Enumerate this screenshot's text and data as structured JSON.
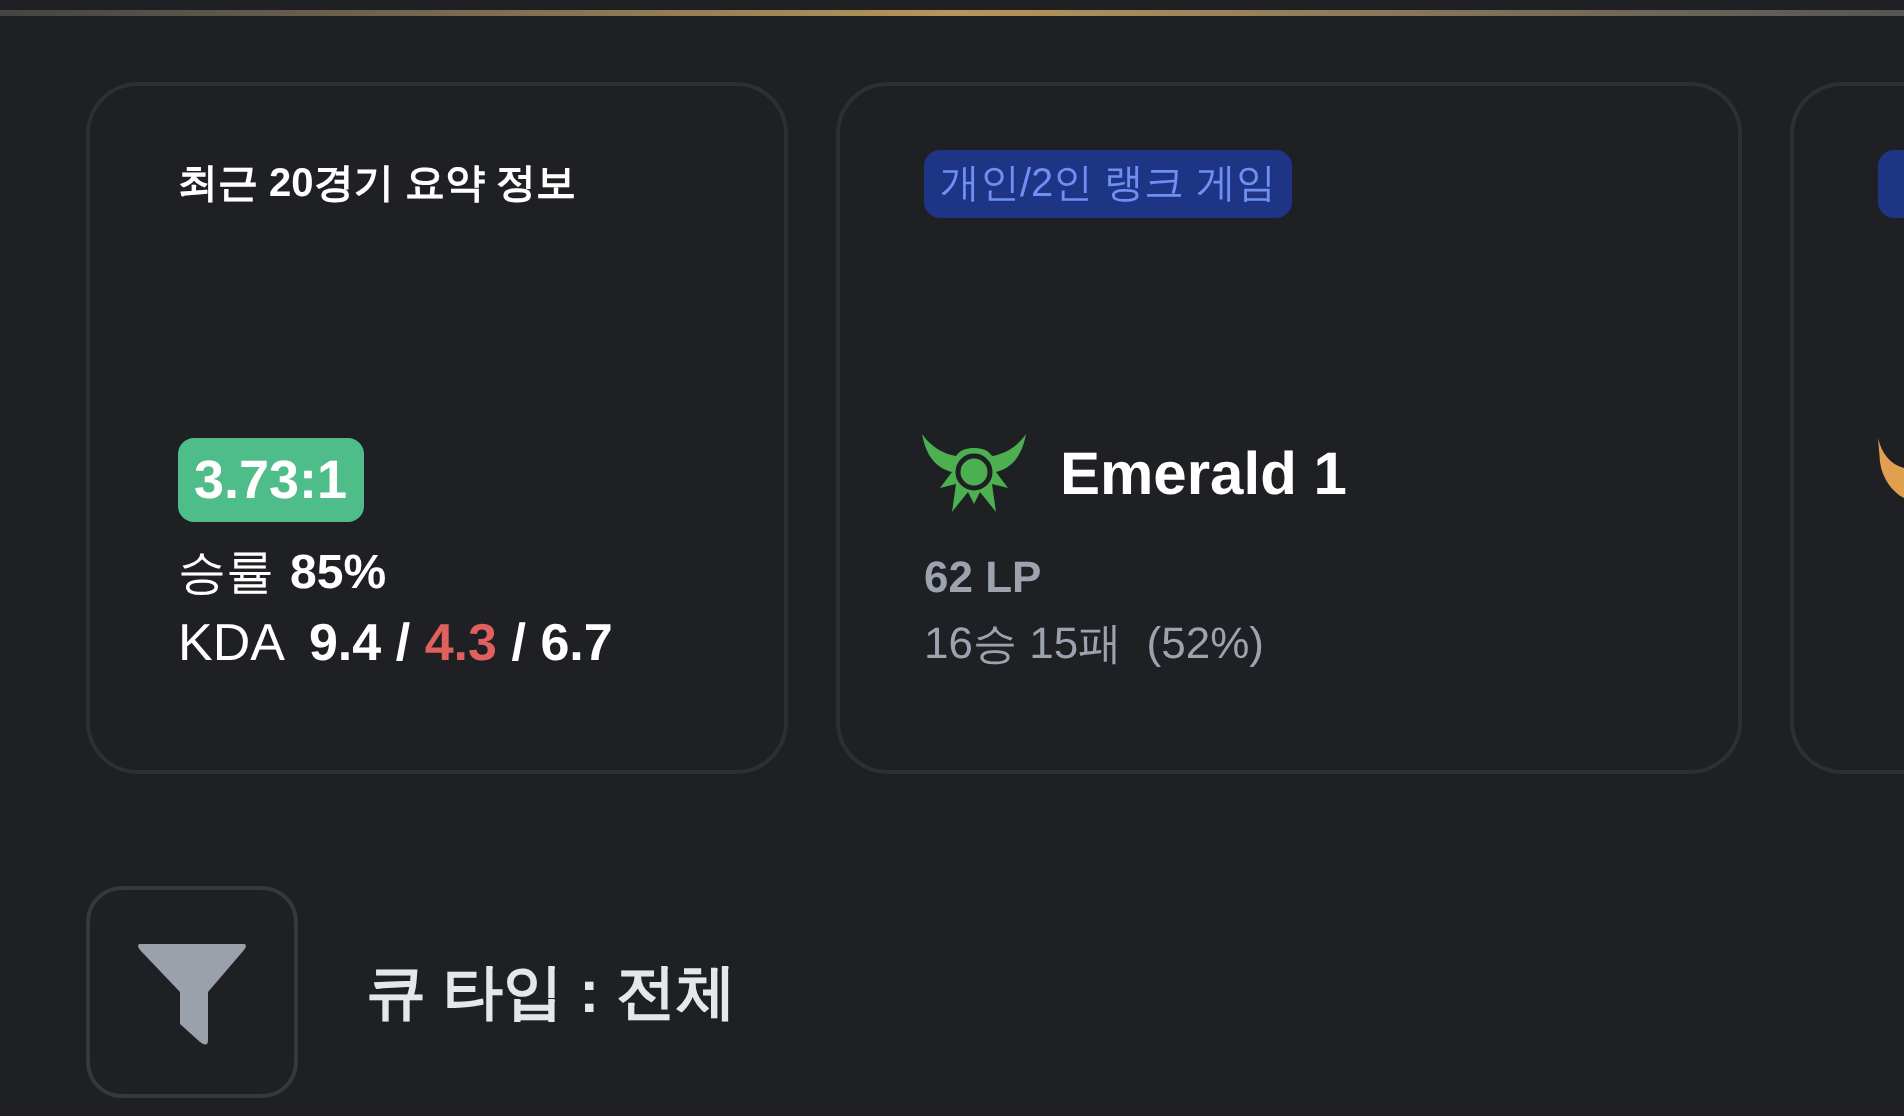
{
  "summary": {
    "title": "최근 20경기 요약 정보",
    "kda_ratio": "3.73:1",
    "win_rate_label": "승률",
    "win_rate": "85%",
    "kda_label": "KDA",
    "kills": "9.4",
    "separator": "/",
    "deaths": "4.3",
    "assists": "6.7"
  },
  "rank_cards": [
    {
      "kind": "full",
      "queue": "개인/2인 랭크 게임",
      "tier": "Emerald 1",
      "lp": "62 LP",
      "record": "16승 15패  (52%)",
      "color": "#4caf50"
    },
    {
      "kind": "cut_off",
      "color": "#e0a050"
    }
  ],
  "filter": {
    "label": "큐 타입 : 전체"
  }
}
